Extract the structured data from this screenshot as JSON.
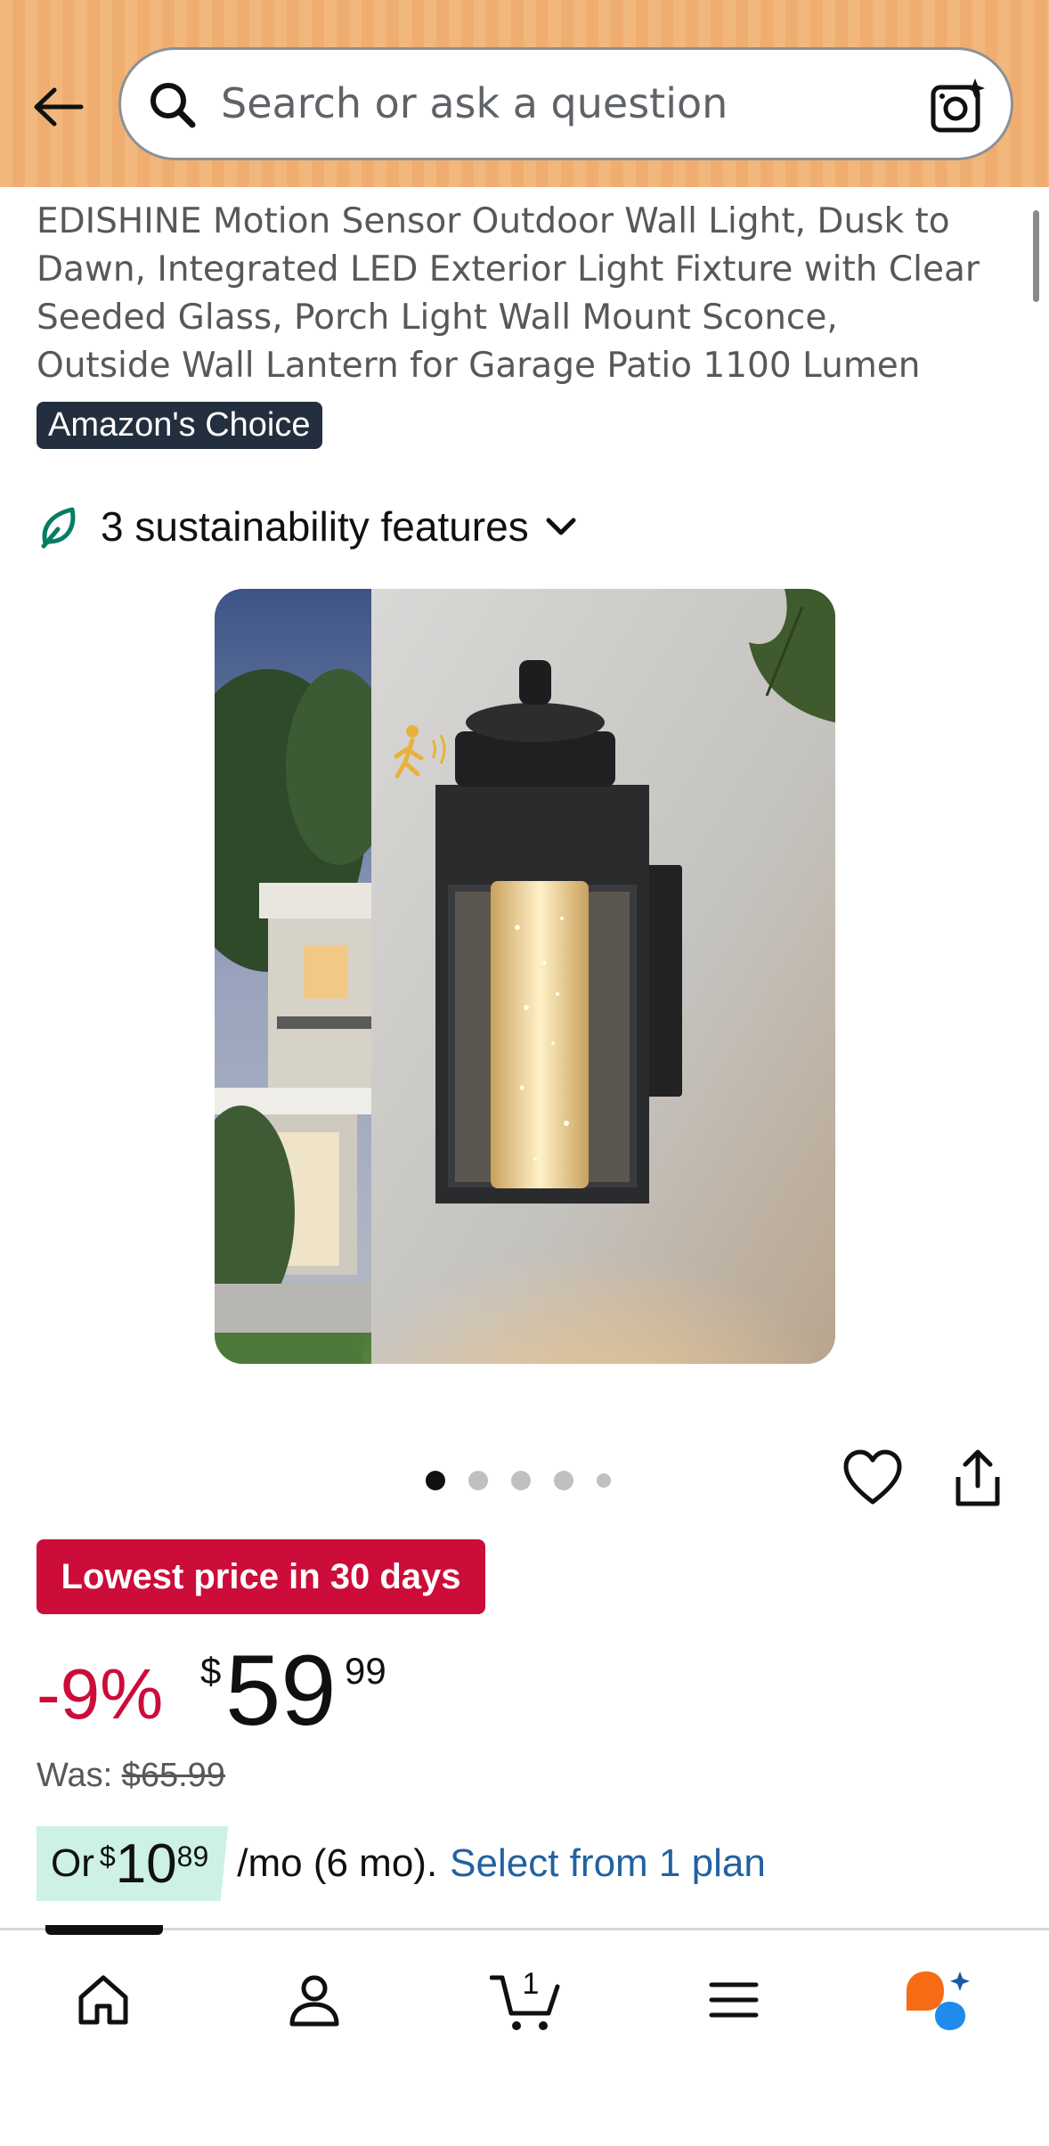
{
  "search": {
    "placeholder": "Search or ask a question"
  },
  "product": {
    "title": "EDISHINE Motion Sensor Outdoor Wall Light, Dusk to Dawn, Integrated LED Exterior Light Fixture with Clear Seeded Glass, Porch Light Wall Mount Sconce, Outside Wall Lantern for Garage Patio 1100 Lumen",
    "badge": "Amazon's Choice",
    "sustainability": "3 sustainability features",
    "image_count": 5,
    "active_image": 1
  },
  "pricing": {
    "deal_badge": "Lowest price in 30 days",
    "discount": "-9%",
    "currency": "$",
    "price_whole": "59",
    "price_fraction": "99",
    "was_label": "Was:",
    "was_value": "$65.99",
    "installment_or": "Or",
    "installment_currency": "$",
    "installment_whole": "10",
    "installment_fraction": "89",
    "installment_terms": "/mo (6 mo).",
    "installment_link": "Select from 1 plan"
  },
  "bottom_nav": {
    "items": [
      "home-icon",
      "account-icon",
      "cart-icon",
      "menu-icon",
      "rufus-icon"
    ],
    "cart_count": "1",
    "active": "home"
  },
  "colors": {
    "header_bg": "#f2b77d",
    "deal_red": "#cc0c39",
    "link_blue": "#2162a1",
    "badge_dark": "#232f3e",
    "installment_highlight": "#cdf1e2"
  }
}
